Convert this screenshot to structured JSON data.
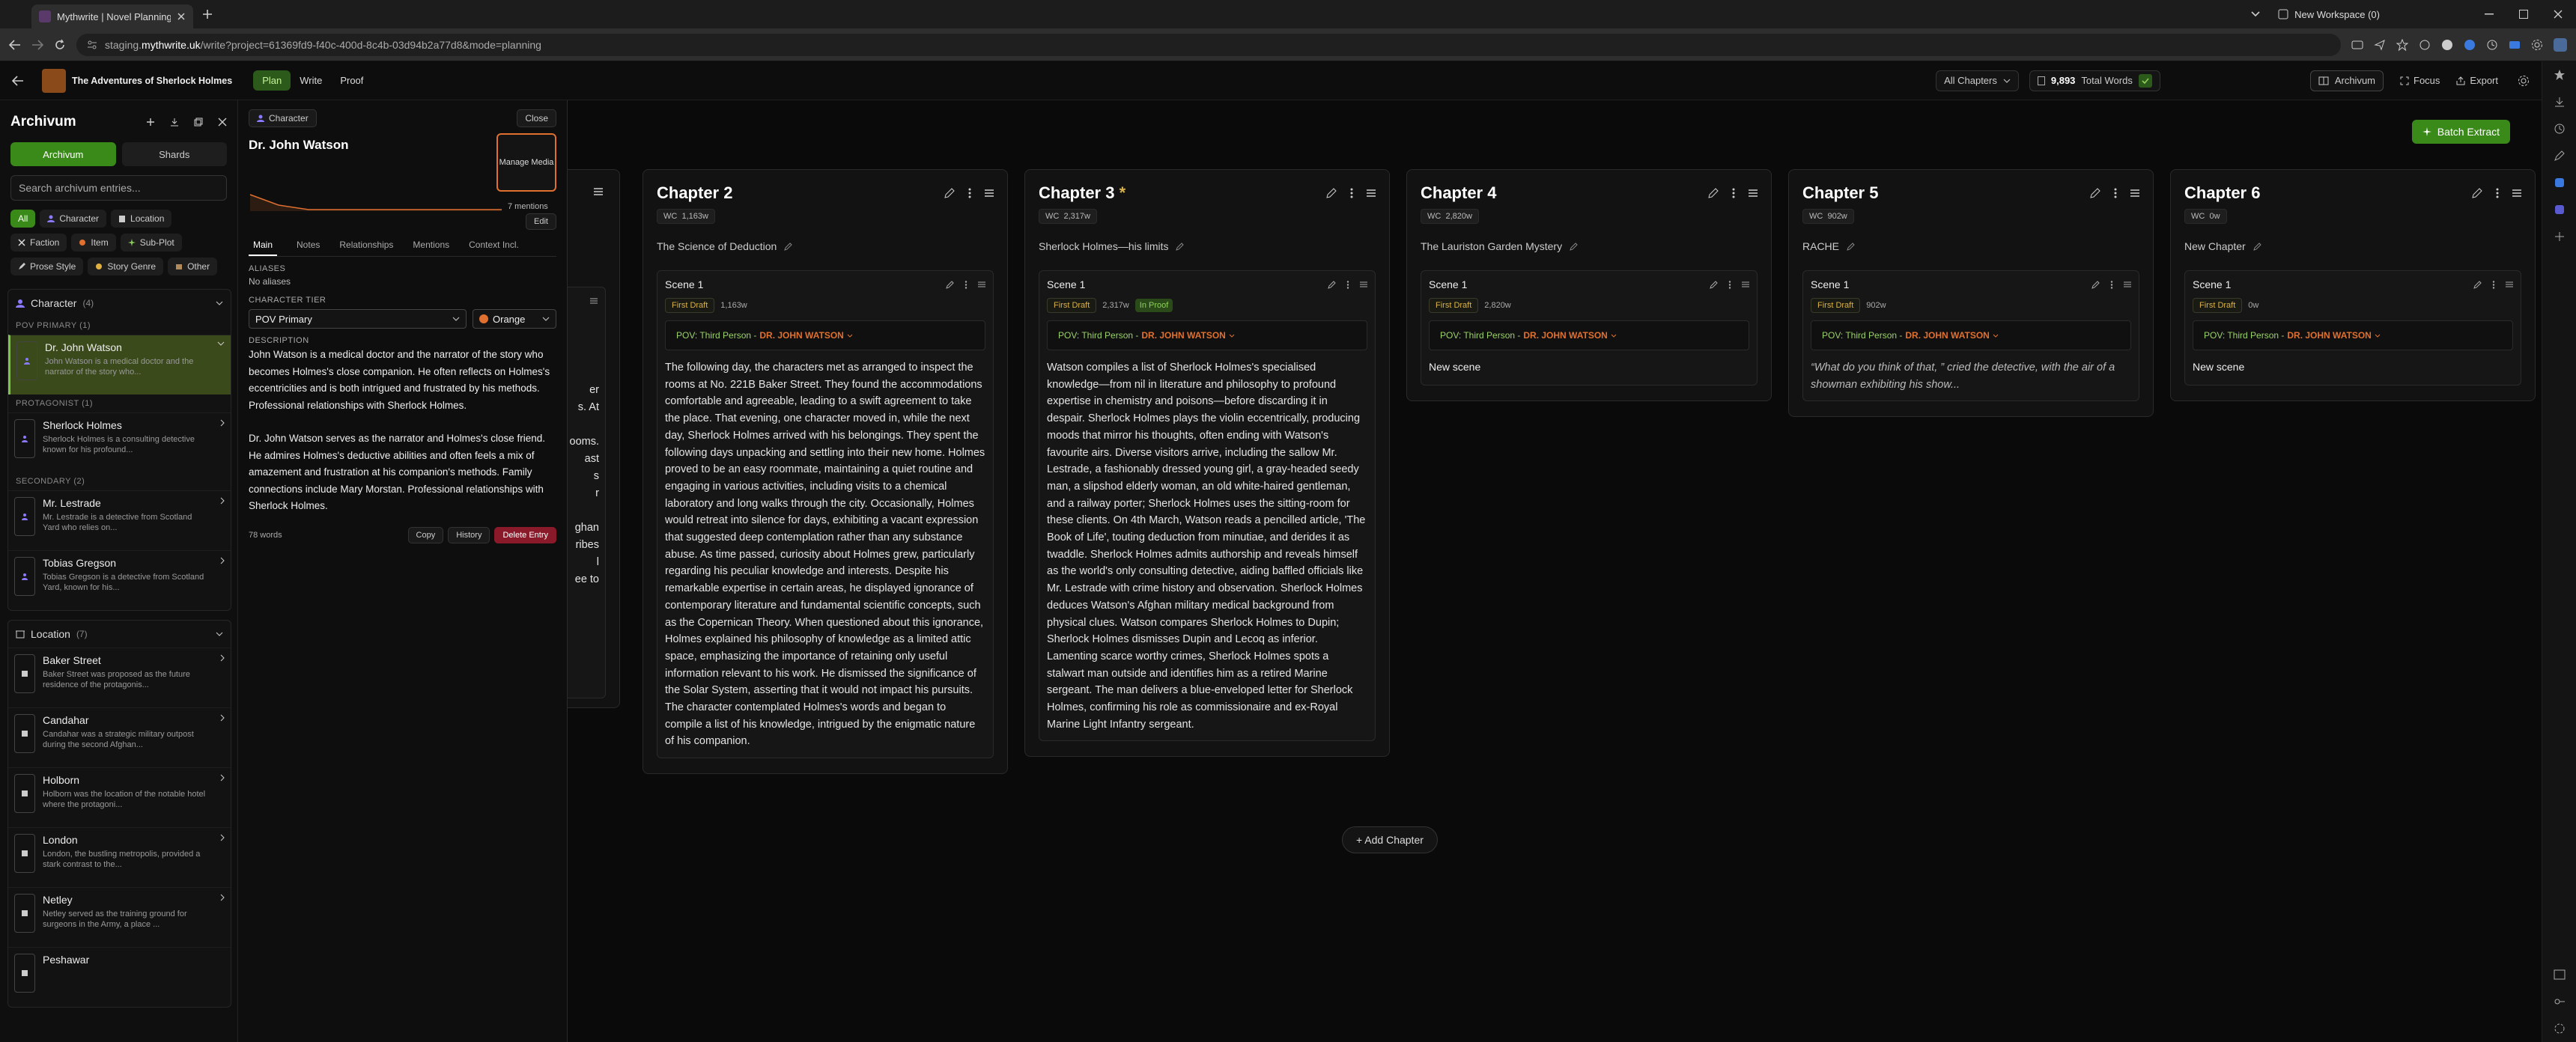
{
  "browser": {
    "tab_title": "Mythwrite | Novel Planning, Wr",
    "url_prefix": "staging.",
    "url_domain": "mythwrite.uk",
    "url_path": "/write?project=61369fd9-f40c-400d-8c4b-03d94b2a77d8&mode=planning",
    "workspace": "New Workspace (0)"
  },
  "header": {
    "project": "The Adventures of Sherlock Holmes",
    "modes": [
      "Plan",
      "Write",
      "Proof"
    ],
    "chapters_filter": "All Chapters",
    "words_count": "9,893",
    "words_label": "Total Words",
    "archivum": "Archivum",
    "focus": "Focus",
    "export": "Export"
  },
  "sidebar": {
    "title": "Archivum",
    "tabs": [
      "Archivum",
      "Shards"
    ],
    "search_placeholder": "Search archivum entries...",
    "chips": [
      "All",
      "Character",
      "Location",
      "Faction",
      "Item",
      "Sub-Plot",
      "Prose Style",
      "Story Genre",
      "Other"
    ],
    "character_section": "Character",
    "character_count": "(4)",
    "groups": {
      "pov": "POV PRIMARY (1)",
      "protagonist": "PROTAGONIST (1)",
      "secondary": "SECONDARY (2)"
    },
    "characters": [
      {
        "name": "Dr. John Watson",
        "desc": "John Watson is a medical doctor and the narrator of the story who..."
      },
      {
        "name": "Sherlock Holmes",
        "desc": "Sherlock Holmes is a consulting detective known for his profound..."
      },
      {
        "name": "Mr. Lestrade",
        "desc": "Mr. Lestrade is a detective from Scotland Yard who relies on..."
      },
      {
        "name": "Tobias Gregson",
        "desc": "Tobias Gregson is a detective from Scotland Yard, known for his..."
      }
    ],
    "location_section": "Location",
    "location_count": "(7)",
    "locations": [
      {
        "name": "Baker Street",
        "desc": "Baker Street was proposed as the future residence of the protagonis..."
      },
      {
        "name": "Candahar",
        "desc": "Candahar was a strategic military outpost during the second Afghan..."
      },
      {
        "name": "Holborn",
        "desc": "Holborn was the location of the notable hotel where the protagoni..."
      },
      {
        "name": "London",
        "desc": "London, the bustling metropolis, provided a stark contrast to the..."
      },
      {
        "name": "Netley",
        "desc": "Netley served as the training ground for surgeons in the Army, a place ..."
      },
      {
        "name": "Peshawar",
        "desc": ""
      }
    ]
  },
  "detail": {
    "type": "Character",
    "close": "Close",
    "name": "Dr. John Watson",
    "manage_media": "Manage Media",
    "mentions": "7 mentions",
    "edit": "Edit",
    "tabs": [
      "Main",
      "Notes",
      "Relationships",
      "Mentions",
      "Context Incl."
    ],
    "aliases_label": "ALIASES",
    "aliases_value": "No aliases",
    "tier_label": "CHARACTER TIER",
    "tier_value": "POV Primary",
    "color_value": "Orange",
    "description_label": "DESCRIPTION",
    "desc_p1": "John Watson is a medical doctor and the narrator of the story who becomes Holmes's close companion. He often reflects on Holmes's eccentricities and is both intrigued and frustrated by his methods. Professional relationships with Sherlock Holmes.",
    "desc_p2": "Dr. John Watson serves as the narrator and Holmes's close friend. He admires Holmes's deductive abilities and often feels a mix of amazement and frustration at his companion's methods. Family connections include Mary Morstan. Professional relationships with Sherlock Holmes.",
    "words": "78 words",
    "copy": "Copy",
    "history": "History",
    "delete": "Delete Entry",
    "chart_color": "#e07030"
  },
  "board": {
    "batch_extract": "Batch Extract",
    "add_chapter": "+ Add Chapter",
    "ch1_fragments": [
      "er",
      "s. At",
      "ooms.",
      "ast",
      "s",
      "r",
      "ghan",
      "ribes",
      "l",
      "ee to"
    ],
    "chapters": [
      {
        "title": "Chapter 2",
        "wc": "1,163w",
        "subtitle": "The Science of Deduction",
        "scene": "Scene 1",
        "status": "First Draft",
        "scene_wc": "1,163w",
        "proof": "",
        "pov_label": "POV: Third Person - ",
        "pov_who": "DR. JOHN WATSON",
        "body": "The following day, the characters met as arranged to inspect the rooms at No. 221B Baker Street. They found the accommodations comfortable and agreeable, leading to a swift agreement to take the place. That evening, one character moved in, while the next day, Sherlock Holmes arrived with his belongings. They spent the following days unpacking and settling into their new home. Holmes proved to be an easy roommate, maintaining a quiet routine and engaging in various activities, including visits to a chemical laboratory and long walks through the city. Occasionally, Holmes would retreat into silence for days, exhibiting a vacant expression that suggested deep contemplation rather than any substance abuse. As time passed, curiosity about Holmes grew, particularly regarding his peculiar knowledge and interests. Despite his remarkable expertise in certain areas, he displayed ignorance of contemporary literature and fundamental scientific concepts, such as the Copernican Theory. When questioned about this ignorance, Holmes explained his philosophy of knowledge as a limited attic space, emphasizing the importance of retaining only useful information relevant to his work. He dismissed the significance of the Solar System, asserting that it would not impact his pursuits. The character contemplated Holmes's words and began to compile a list of his knowledge, intrigued by the enigmatic nature of his companion."
      },
      {
        "title": "Chapter 3",
        "star": "*",
        "wc": "2,317w",
        "subtitle": "Sherlock Holmes—his limits",
        "scene": "Scene 1",
        "status": "First Draft",
        "scene_wc": "2,317w",
        "proof": "In Proof",
        "pov_label": "POV: Third Person - ",
        "pov_who": "DR. JOHN WATSON",
        "body": "Watson compiles a list of Sherlock Holmes's specialised knowledge—from nil in literature and philosophy to profound expertise in chemistry and poisons—before discarding it in despair. Sherlock Holmes plays the violin eccentrically, producing moods that mirror his thoughts, often ending with Watson's favourite airs. Diverse visitors arrive, including the sallow Mr. Lestrade, a fashionably dressed young girl, a gray-headed seedy man, a slipshod elderly woman, an old white-haired gentleman, and a railway porter; Sherlock Holmes uses the sitting-room for these clients. On 4th March, Watson reads a pencilled article, 'The Book of Life', touting deduction from minutiae, and derides it as twaddle. Sherlock Holmes admits authorship and reveals himself as the world's only consulting detective, aiding baffled officials like Mr. Lestrade with crime history and observation. Sherlock Holmes deduces Watson's Afghan military medical background from physical clues. Watson compares Sherlock Holmes to Dupin; Sherlock Holmes dismisses Dupin and Lecoq as inferior. Lamenting scarce worthy crimes, Sherlock Holmes spots a stalwart man outside and identifies him as a retired Marine sergeant. The man delivers a blue-enveloped letter for Sherlock Holmes, confirming his role as commissionaire and ex-Royal Marine Light Infantry sergeant."
      },
      {
        "title": "Chapter 4",
        "wc": "2,820w",
        "subtitle": "The Lauriston Garden Mystery",
        "scene": "Scene 1",
        "status": "First Draft",
        "scene_wc": "2,820w",
        "proof": "",
        "pov_label": "POV: Third Person - ",
        "pov_who": "DR. JOHN WATSON",
        "body": "New scene",
        "newscene": true
      },
      {
        "title": "Chapter 5",
        "wc": "902w",
        "subtitle": "RACHE",
        "scene": "Scene 1",
        "status": "First Draft",
        "scene_wc": "902w",
        "proof": "",
        "pov_label": "POV: Third Person - ",
        "pov_who": "DR. JOHN WATSON",
        "body": "“What do you think of that, ” cried the detective, with the air of a showman exhibiting his show...",
        "italic": true
      },
      {
        "title": "Chapter 6",
        "wc": "0w",
        "subtitle": "New Chapter",
        "scene": "Scene 1",
        "status": "First Draft",
        "scene_wc": "0w",
        "proof": "",
        "pov_label": "POV: Third Person - ",
        "pov_who": "DR. JOHN WATSON",
        "body": "New scene",
        "newscene": true
      }
    ]
  }
}
